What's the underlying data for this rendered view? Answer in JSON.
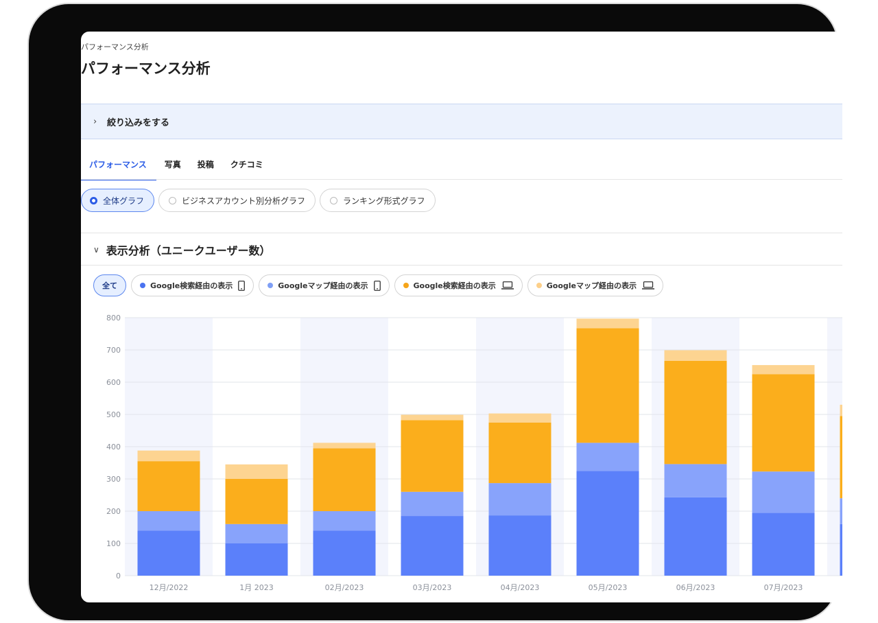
{
  "breadcrumb": "パフォーマンス分析",
  "page_title": "パフォーマンス分析",
  "filter": {
    "label": "絞り込みをする"
  },
  "tabs": [
    {
      "label": "パフォーマンス",
      "active": true
    },
    {
      "label": "写真",
      "active": false
    },
    {
      "label": "投稿",
      "active": false
    },
    {
      "label": "クチコミ",
      "active": false
    }
  ],
  "graph_modes": [
    {
      "label": "全体グラフ",
      "selected": true
    },
    {
      "label": "ビジネスアカウント別分析グラフ",
      "selected": false
    },
    {
      "label": "ランキング形式グラフ",
      "selected": false
    }
  ],
  "section": {
    "title": "表示分析（ユニークユーザー数）"
  },
  "legend": {
    "all_label": "全て",
    "items": [
      {
        "label": "Google検索経由の表示",
        "color": "#4a73f0",
        "device_icon": "smartphone-icon"
      },
      {
        "label": "Googleマップ経由の表示",
        "color": "#7f9ff5",
        "device_icon": "smartphone-icon"
      },
      {
        "label": "Google検索経由の表示",
        "color": "#f6a51a",
        "device_icon": "laptop-icon"
      },
      {
        "label": "Googleマップ経由の表示",
        "color": "#fdd08a",
        "device_icon": "laptop-icon"
      }
    ]
  },
  "chart_data": {
    "type": "bar",
    "stacked": true,
    "categories": [
      "12月/2022",
      "1月 2023",
      "02月/2023",
      "03月/2023",
      "04月/2023",
      "05月/2023",
      "06月/2023",
      "07月/2023",
      ""
    ],
    "series": [
      {
        "name": "Google検索経由の表示",
        "color": "#5b80fa",
        "values": [
          140,
          100,
          140,
          185,
          187,
          325,
          243,
          195,
          160
        ]
      },
      {
        "name": "Googleマップ経由の表示",
        "color": "#88a3fb",
        "values": [
          60,
          60,
          60,
          75,
          100,
          87,
          103,
          128,
          80
        ]
      },
      {
        "name": "Google検索経由の表示",
        "color": "#fbae1c",
        "values": [
          155,
          140,
          195,
          222,
          188,
          355,
          320,
          302,
          255
        ]
      },
      {
        "name": "Googleマップ経由の表示",
        "color": "#fdd491",
        "values": [
          33,
          45,
          17,
          17,
          28,
          30,
          33,
          28,
          35
        ]
      }
    ],
    "ylim": [
      0,
      800
    ],
    "yticks": [
      0,
      100,
      200,
      300,
      400,
      500,
      600,
      700,
      800
    ],
    "grid": true
  }
}
